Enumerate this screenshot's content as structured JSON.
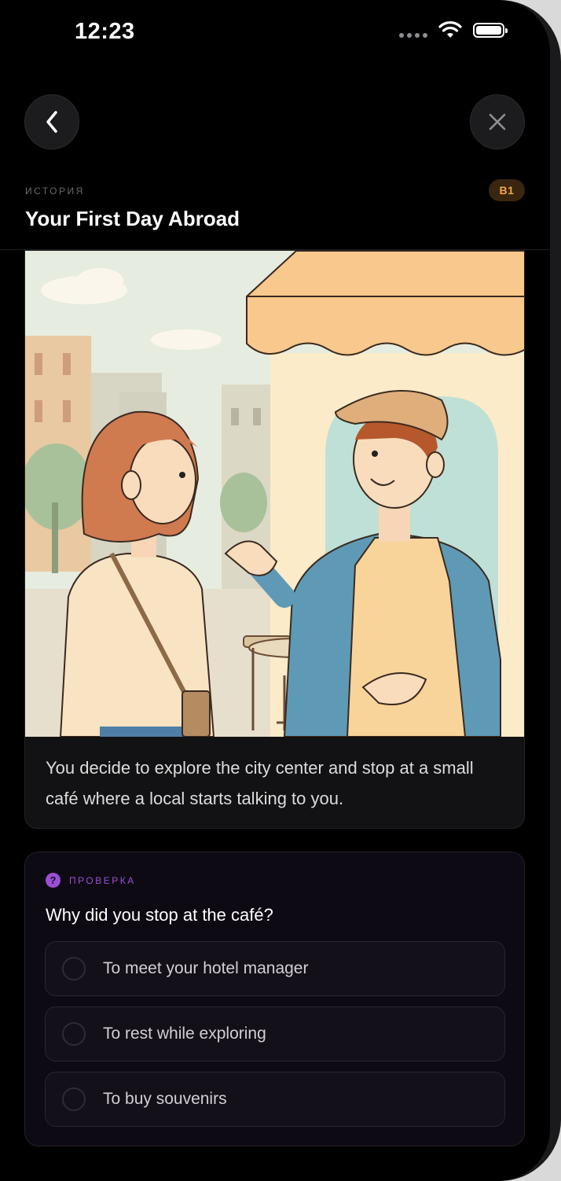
{
  "status_bar": {
    "time": "12:23"
  },
  "nav": {
    "back_icon": "chevron-left-icon",
    "close_icon": "close-icon"
  },
  "header": {
    "eyebrow": "ИСТОРИЯ",
    "level": "B1",
    "title": "Your First Day Abroad"
  },
  "story": {
    "text": "You decide to explore the city center and stop at a small café where a local starts talking to you."
  },
  "quiz": {
    "label": "ПРОВЕРКА",
    "icon": "?",
    "question": "Why did you stop at the café?",
    "options": [
      {
        "label": "To meet your hotel manager"
      },
      {
        "label": "To rest while exploring"
      },
      {
        "label": "To buy souvenirs"
      }
    ]
  },
  "colors": {
    "background": "#000000",
    "card": "#121214",
    "quiz_accent": "#9b4fd3",
    "level_badge_text": "#f0a64a",
    "level_badge_bg": "#3a2610"
  }
}
